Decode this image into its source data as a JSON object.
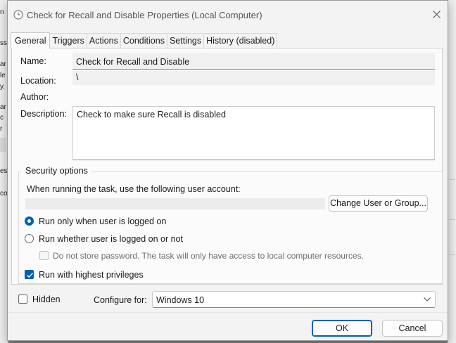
{
  "background": {
    "left_fragments": [
      "n",
      "ss",
      "ar",
      "le",
      "y.",
      "ar",
      "c",
      "r",
      "es",
      "co"
    ]
  },
  "window": {
    "title": "Check for Recall and Disable Properties (Local Computer)"
  },
  "tabs": [
    {
      "label": "General",
      "active": true
    },
    {
      "label": "Triggers"
    },
    {
      "label": "Actions"
    },
    {
      "label": "Conditions"
    },
    {
      "label": "Settings"
    },
    {
      "label": "History (disabled)"
    }
  ],
  "general": {
    "name_label": "Name:",
    "name_value": "Check for Recall and Disable",
    "location_label": "Location:",
    "location_value": "\\",
    "author_label": "Author:",
    "author_value": "",
    "description_label": "Description:",
    "description_value": "Check to make sure Recall is disabled"
  },
  "security": {
    "group_title": "Security options",
    "account_prompt": "When running the task, use the following user account:",
    "account_value": "",
    "change_user_button": "Change User or Group...",
    "radio_logged_on": "Run only when user is logged on",
    "radio_logged_on_checked": true,
    "radio_whether": "Run whether user is logged on or not",
    "radio_whether_checked": false,
    "no_store_password": "Do not store password.  The task will only have access to local computer resources.",
    "highest_privileges": "Run with highest privileges",
    "highest_privileges_checked": true
  },
  "bottom": {
    "hidden_label": "Hidden",
    "hidden_checked": false,
    "configure_label": "Configure for:",
    "configure_value": "Windows 10"
  },
  "buttons": {
    "ok": "OK",
    "cancel": "Cancel"
  },
  "colors": {
    "accent": "#005fb8"
  }
}
